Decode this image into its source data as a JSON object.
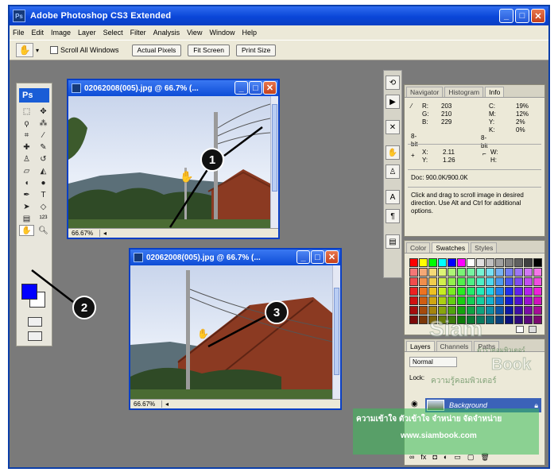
{
  "app": {
    "title": "Adobe Photoshop CS3 Extended",
    "logo": "Ps",
    "menu": [
      "File",
      "Edit",
      "Image",
      "Layer",
      "Select",
      "Filter",
      "Analysis",
      "View",
      "Window",
      "Help"
    ]
  },
  "options_bar": {
    "scroll_all_windows": "Scroll All Windows",
    "actual_pixels": "Actual Pixels",
    "fit_screen": "Fit Screen",
    "print_size": "Print Size"
  },
  "doc1": {
    "title": "02062008(005).jpg @ 66.7% (...",
    "zoom": "66.67%"
  },
  "doc2": {
    "title": "02062008(005).jpg @ 66.7% (...",
    "zoom": "66.67%"
  },
  "info_panel": {
    "tabs": [
      "Navigator",
      "Histogram",
      "Info"
    ],
    "r": "203",
    "g": "210",
    "b": "229",
    "c": "19%",
    "m": "12%",
    "y": "2%",
    "k": "0%",
    "bit_left": "8-bit",
    "bit_right": "8-bit",
    "x": "2.11",
    "y2": "1.26",
    "w": "",
    "h": "",
    "doc": "Doc: 900.0K/900.0K",
    "hint": "Click and drag to scroll image in desired direction.  Use Alt and Ctrl for additional options."
  },
  "swatches_panel": {
    "tabs": [
      "Color",
      "Swatches",
      "Styles"
    ]
  },
  "layers_panel": {
    "tabs": [
      "Layers",
      "Channels",
      "Paths"
    ],
    "mode": "Normal",
    "lock_label": "Lock:",
    "layer_name": "Background"
  },
  "callouts": [
    "1",
    "2",
    "3"
  ],
  "watermark": {
    "brand1": "Siam",
    "brand2": "Book",
    "thai1": "ตำราคอมพิวเตอร์",
    "thai2": "ความรู้คอมพิวเตอร์",
    "line1": "ความเข้าใจ ตัวเข้าใจ จำหน่าย จัดจำหน่าย",
    "url": "www.siambook.com"
  },
  "colors": {
    "title_blue": "#0a46d8",
    "chrome": "#ece9d8",
    "canvas_gray": "#7a7a7a",
    "fg_color": "#0000ff"
  }
}
